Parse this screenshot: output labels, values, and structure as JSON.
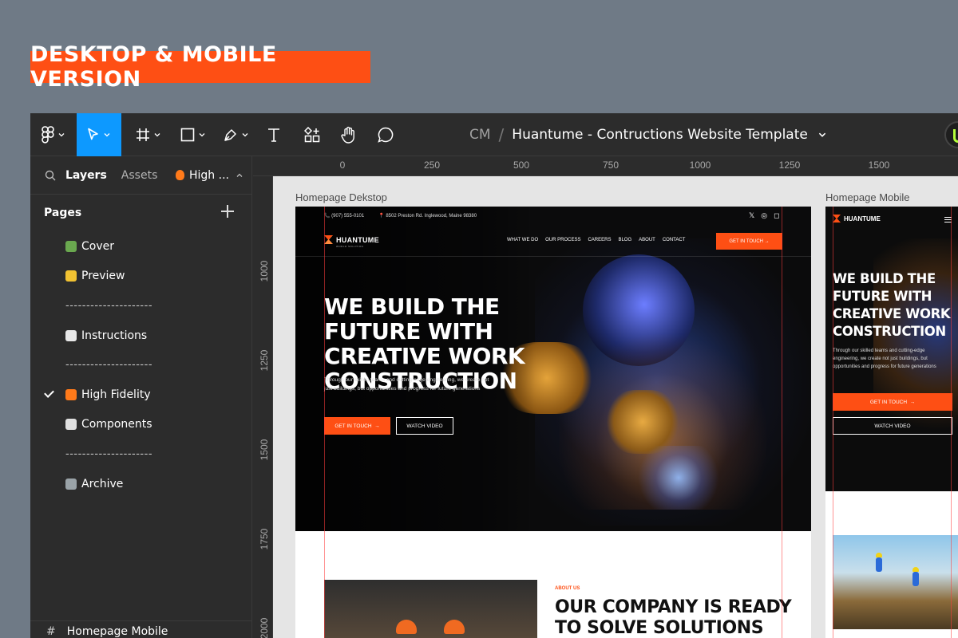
{
  "banner": {
    "text": "DESKTOP & MOBILE VERSION",
    "color": "#fe4f14"
  },
  "toolbar": {
    "breadcrumb_team": "CM",
    "breadcrumb_sep": "/",
    "file_title": "Huantume - Contructions Website Template"
  },
  "sidebar": {
    "tabs": [
      "Layers",
      "Assets"
    ],
    "page_selector": "High ...",
    "pages_heading": "Pages",
    "pages": [
      {
        "label": "Cover",
        "icon": "picture-emoji",
        "color": "#6aa84f"
      },
      {
        "label": "Preview",
        "icon": "sparkle-emoji",
        "color": "#f1c232"
      },
      {
        "label": "---------------------",
        "divider": true
      },
      {
        "label": "Instructions",
        "icon": "memo-emoji",
        "color": "#e8e8e8"
      },
      {
        "label": "---------------------",
        "divider": true
      },
      {
        "label": "High Fidelity",
        "icon": "fire-emoji",
        "color": "#ff7a1a",
        "selected": true
      },
      {
        "label": "Components",
        "icon": "dice-emoji",
        "color": "#e0e0e0"
      },
      {
        "label": "---------------------",
        "divider": true
      },
      {
        "label": "Archive",
        "icon": "trash-emoji",
        "color": "#9aa3a8"
      }
    ],
    "bottom_layer": "Homepage Mobile"
  },
  "rulers": {
    "top": [
      "0",
      "250",
      "500",
      "750",
      "1000",
      "1250",
      "1500"
    ],
    "left": [
      "1000",
      "1250",
      "1500",
      "1750",
      "2000"
    ]
  },
  "frames": {
    "desktop_label": "Homepage Dekstop",
    "mobile_label": "Homepage Mobile"
  },
  "site": {
    "phone": "(907) 555-0101",
    "address": "8502 Preston Rd. Inglewood, Maine 98380",
    "brand": "HUANTUME",
    "tagline": "WORLD SOLUTION",
    "nav": [
      "WHAT WE DO",
      "OUR PROCESS",
      "CAREERS",
      "BLOG",
      "ABOUT",
      "CONTACT"
    ],
    "nav_cta": "GET IN TOUCH",
    "hero_title": "WE BUILD THE FUTURE WITH CREATIVE WORK CONSTRUCTION",
    "hero_sub": "Through our skilled teams and cutting-edge engineering, we create not just buildings, but opportunities and progress for future generations",
    "btn_primary": "GET IN TOUCH",
    "btn_secondary": "WATCH VIDEO",
    "about_tag": "ABOUT US",
    "about_title": "OUR COMPANY IS READY TO SOLVE SOLUTIONS INTO"
  },
  "mobile": {
    "brand": "HUANTUME",
    "hero_title": "WE BUILD THE FUTURE WITH CREATIVE WORK CONSTRUCTION",
    "hero_sub": "Through our skilled teams and cutting-edge engineering, we create not just buildings, but opportunities and progress for future generations",
    "btn_primary": "GET IN TOUCH",
    "btn_secondary": "WATCH VIDEO"
  }
}
